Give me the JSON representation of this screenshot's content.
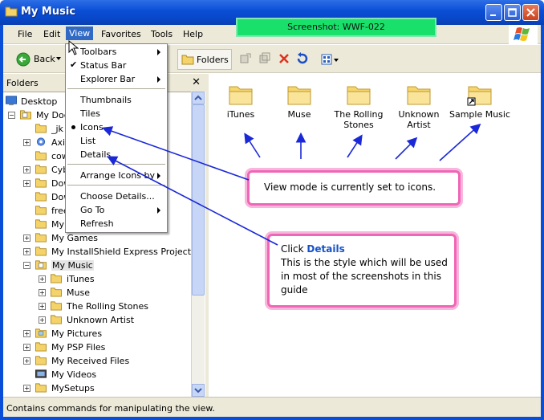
{
  "window": {
    "title": "My Music"
  },
  "badge": "Screenshot: WWF-022",
  "menubar": [
    "File",
    "Edit",
    "View",
    "Favorites",
    "Tools",
    "Help"
  ],
  "toolbar": {
    "back": "Back",
    "folders": "Folders"
  },
  "folders_pane": {
    "header": "Folders"
  },
  "tree": [
    {
      "label": "Desktop"
    },
    {
      "label": "My Doc"
    },
    {
      "label": "_jk"
    },
    {
      "label": "Axi"
    },
    {
      "label": "cow"
    },
    {
      "label": "Cyb"
    },
    {
      "label": "Dow"
    },
    {
      "label": "Dow"
    },
    {
      "label": "free"
    },
    {
      "label": "My"
    },
    {
      "label": "My Games"
    },
    {
      "label": "My InstallShield Express Projects"
    },
    {
      "label": "My Music"
    },
    {
      "label": "iTunes"
    },
    {
      "label": "Muse"
    },
    {
      "label": "The Rolling Stones"
    },
    {
      "label": "Unknown Artist"
    },
    {
      "label": "My Pictures"
    },
    {
      "label": "My PSP Files"
    },
    {
      "label": "My Received Files"
    },
    {
      "label": "My Videos"
    },
    {
      "label": "MySetups"
    }
  ],
  "view_menu": {
    "items": [
      "Toolbars",
      "Status Bar",
      "Explorer Bar",
      "Thumbnails",
      "Tiles",
      "Icons",
      "List",
      "Details",
      "Arrange Icons by",
      "Choose Details...",
      "Go To",
      "Refresh"
    ]
  },
  "content_items": [
    {
      "label": "iTunes"
    },
    {
      "label": "Muse"
    },
    {
      "label": "The Rolling Stones"
    },
    {
      "label": "Unknown Artist"
    },
    {
      "label": "Sample Music"
    }
  ],
  "callout_view": "View mode is currently set to icons.",
  "callout_details": {
    "prefix": "Click ",
    "highlight": "Details",
    "body": "This is the style which will be used in most of the screenshots in this guide"
  },
  "statusbar": "Contains commands for manipulating the view.",
  "colors": {
    "titlebar": "#0a4dd6",
    "callout_border": "#f066b6",
    "arrow": "#1a28d8",
    "highlight": "#1652c8"
  }
}
